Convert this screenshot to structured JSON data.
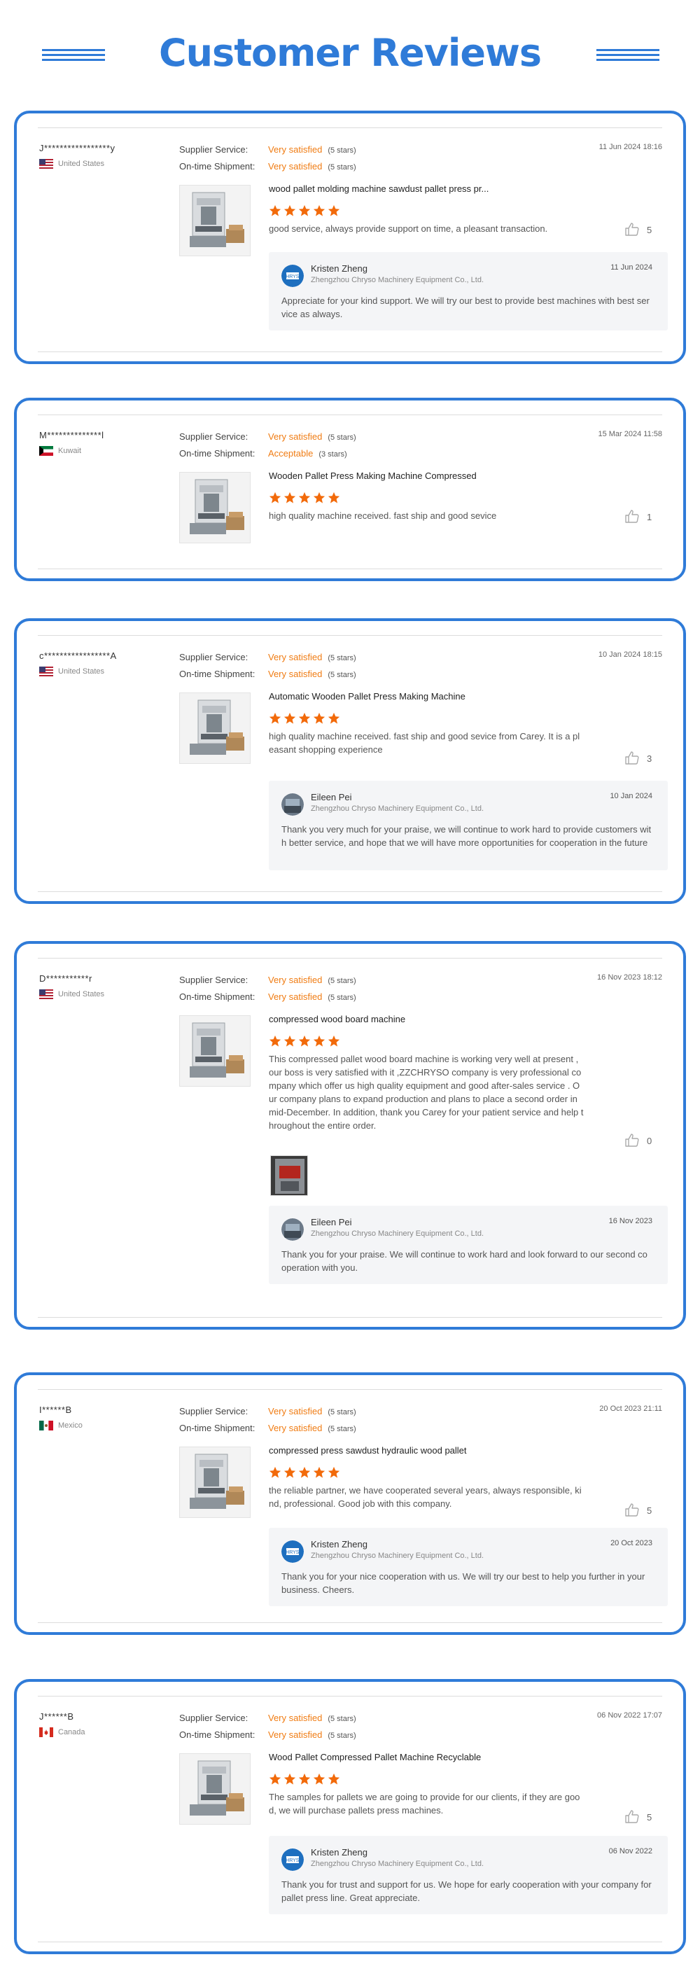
{
  "page": {
    "title": "Customer Reviews"
  },
  "labels": {
    "supplier_service": "Supplier Service:",
    "on_time_shipment": "On-time Shipment:"
  },
  "reviews": [
    {
      "reviewer": "J*****************y",
      "country": "United States",
      "flag": "us-flag-icon",
      "supplier_value": "Very satisfied",
      "supplier_stars": "(5 stars)",
      "shipment_value": "Very satisfied",
      "shipment_stars": "(5 stars)",
      "date": "11 Jun 2024 18:16",
      "product": "wood pallet molding machine sawdust pallet press pr...",
      "rating": 5,
      "comment": "good service, always provide support on time, a pleasant transaction.",
      "likes": "5",
      "reply": {
        "name": "Kristen Zheng",
        "company": "Zhengzhou Chryso Machinery Equipment Co., Ltd.",
        "date": "11 Jun 2024",
        "text": "Appreciate for your kind support. We will try our best to provide best machines with best service as always."
      }
    },
    {
      "reviewer": "M**************l",
      "country": "Kuwait",
      "flag": "kuwait-flag-icon",
      "supplier_value": "Very satisfied",
      "supplier_stars": "(5 stars)",
      "shipment_value": "Acceptable",
      "shipment_stars": "(3 stars)",
      "date": "15 Mar 2024 11:58",
      "product": "Wooden Pallet Press Making Machine Compressed",
      "rating": 5,
      "comment": "high quality machine received. fast ship and good sevice",
      "likes": "1"
    },
    {
      "reviewer": "c*****************A",
      "country": "United States",
      "flag": "us-flag-icon",
      "supplier_value": "Very satisfied",
      "supplier_stars": "(5 stars)",
      "shipment_value": "Very satisfied",
      "shipment_stars": "(5 stars)",
      "date": "10 Jan 2024 18:15",
      "product": "Automatic Wooden Pallet Press Making Machine",
      "rating": 5,
      "comment": "high quality machine received. fast ship and good sevice from Carey. It is a pleasant shopping experience",
      "likes": "3",
      "reply": {
        "name": "Eileen Pei",
        "company": "Zhengzhou Chryso Machinery Equipment Co., Ltd.",
        "date": "10 Jan 2024",
        "text": "Thank you very much for your praise, we will continue to work hard to provide customers with better service, and hope that we will have more opportunities for cooperation in the future"
      }
    },
    {
      "reviewer": "D***********r",
      "country": "United States",
      "flag": "us-flag-icon",
      "supplier_value": "Very satisfied",
      "supplier_stars": "(5 stars)",
      "shipment_value": "Very satisfied",
      "shipment_stars": "(5 stars)",
      "date": "16 Nov 2023 18:12",
      "product": "compressed wood board machine",
      "rating": 5,
      "comment": "This compressed pallet wood board machine is working very well at present , our boss is very satisfied with it ,ZZCHRYSO company is very professional company which offer us high quality equipment and good after-sales service . Our company plans to expand production and plans to place a second order in mid-December. In addition, thank you Carey for your patient service and help throughout the entire order.",
      "likes": "0",
      "reply": {
        "name": "Eileen Pei",
        "company": "Zhengzhou Chryso Machinery Equipment Co., Ltd.",
        "date": "16 Nov 2023",
        "text": "Thank you for your praise. We will continue to work hard and look forward to our second cooperation with you."
      }
    },
    {
      "reviewer": "I******B",
      "country": "Mexico",
      "flag": "mexico-flag-icon",
      "supplier_value": "Very satisfied",
      "supplier_stars": "(5 stars)",
      "shipment_value": "Very satisfied",
      "shipment_stars": "(5 stars)",
      "date": "20 Oct 2023 21:11",
      "product": "compressed press sawdust hydraulic wood pallet",
      "rating": 5,
      "comment": "the reliable partner, we have cooperated several years, always responsible, kind, professional. Good job with this company.",
      "likes": "5",
      "reply": {
        "name": "Kristen Zheng",
        "company": "Zhengzhou Chryso Machinery Equipment Co., Ltd.",
        "date": "20 Oct 2023",
        "text": "Thank you for your nice cooperation with us. We will try our best to help you further in your business. Cheers."
      }
    },
    {
      "reviewer": "J******B",
      "country": "Canada",
      "flag": "canada-flag-icon",
      "supplier_value": "Very satisfied",
      "supplier_stars": "(5 stars)",
      "shipment_value": "Very satisfied",
      "shipment_stars": "(5 stars)",
      "date": "06 Nov 2022 17:07",
      "product": "Wood Pallet Compressed Pallet Machine Recyclable",
      "rating": 5,
      "comment": "The samples for pallets we are going to provide for our clients, if they are good, we will purchase pallets press machines.",
      "likes": "5",
      "reply": {
        "name": "Kristen Zheng",
        "company": "Zhengzhou Chryso Machinery Equipment Co., Ltd.",
        "date": "06 Nov 2022",
        "text": "Thank you for trust and support for us. We hope for early cooperation with your company for pallet press line. Great appreciate."
      }
    }
  ]
}
